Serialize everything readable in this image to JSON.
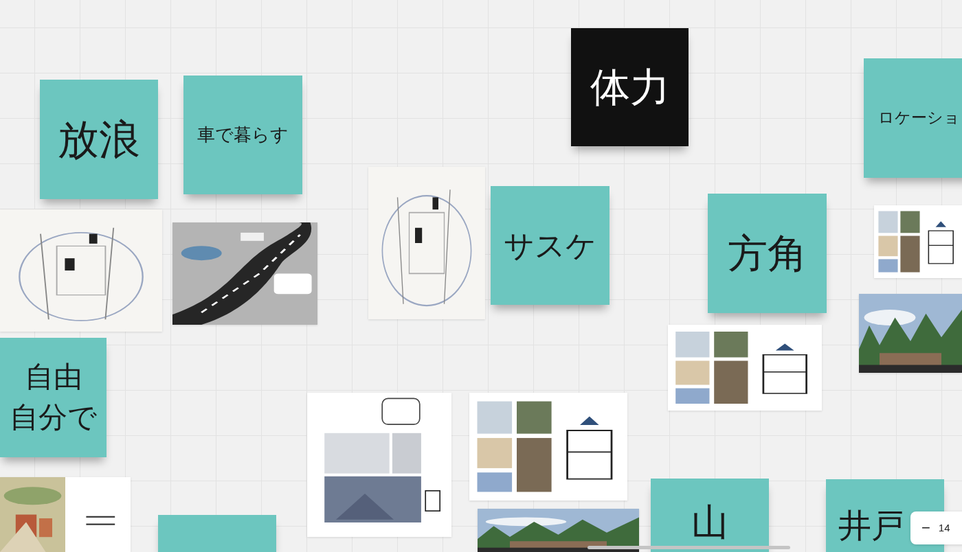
{
  "board": {
    "items": [
      {
        "kind": "note",
        "text": "体力",
        "color": "#111111"
      },
      {
        "kind": "note",
        "text": "ロケーショ",
        "color": "#6cc6bf"
      },
      {
        "kind": "note",
        "text": "放浪",
        "color": "#6cc6bf"
      },
      {
        "kind": "note",
        "text": "車で暮らす",
        "color": "#6cc6bf"
      },
      {
        "kind": "picture"
      },
      {
        "kind": "note",
        "text": "サスケ",
        "color": "#6cc6bf"
      },
      {
        "kind": "note",
        "text": "方角",
        "color": "#6cc6bf"
      },
      {
        "kind": "picture"
      },
      {
        "kind": "picture"
      },
      {
        "kind": "picture"
      },
      {
        "kind": "picture"
      },
      {
        "kind": "picture"
      },
      {
        "kind": "note",
        "lines": [
          "自由",
          "自分で"
        ],
        "color": "#6cc6bf"
      },
      {
        "kind": "picture"
      },
      {
        "kind": "picture"
      },
      {
        "kind": "picture"
      },
      {
        "kind": "picture"
      },
      {
        "kind": "note",
        "color": "#6cc6bf"
      },
      {
        "kind": "note",
        "text": "山",
        "color": "#6cc6bf"
      },
      {
        "kind": "note",
        "text": "井戸",
        "color": "#6cc6bf"
      }
    ]
  },
  "zoom_control": {
    "minus": "−",
    "value": "14"
  }
}
